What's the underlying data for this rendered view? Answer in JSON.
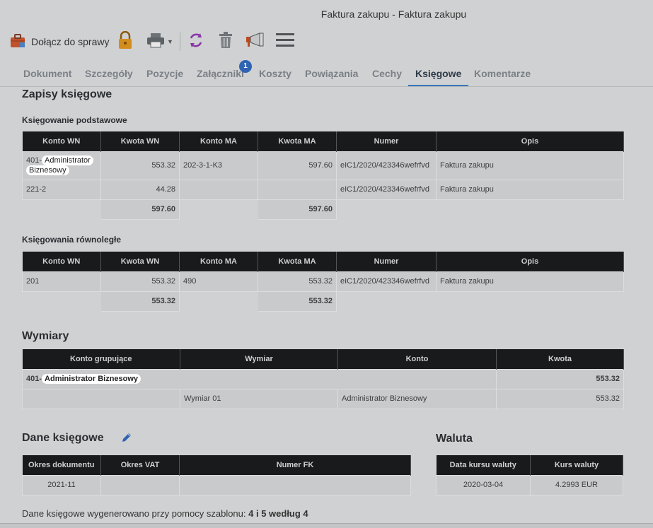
{
  "window": {
    "title": "Faktura zakupu - Faktura zakupu"
  },
  "toolbar": {
    "join_label": "Dołącz do sprawy",
    "icons": [
      "briefcase-icon",
      "lock-icon",
      "printer-icon",
      "refresh-icon",
      "trash-icon",
      "megaphone-icon",
      "menu-icon"
    ]
  },
  "tabs": [
    {
      "label": "Dokument"
    },
    {
      "label": "Szczegóły"
    },
    {
      "label": "Pozycje"
    },
    {
      "label": "Załączniki",
      "badge": "1"
    },
    {
      "label": "Koszty"
    },
    {
      "label": "Powiązania"
    },
    {
      "label": "Cechy"
    },
    {
      "label": "Księgowe",
      "active": true
    },
    {
      "label": "Komentarze"
    }
  ],
  "zapisy": {
    "title": "Zapisy księgowe",
    "podstawowe": {
      "title": "Księgowanie podstawowe",
      "headers": [
        "Konto WN",
        "Kwota WN",
        "Konto MA",
        "Kwota MA",
        "Numer",
        "Opis"
      ],
      "rows": [
        {
          "konto_wn_prefix": "401-",
          "konto_wn_name_1": "Administrator",
          "konto_wn_name_2": "Biznesowy",
          "kwota_wn": "553.32",
          "konto_ma": "202-3-1-K3",
          "kwota_ma": "597.60",
          "numer": "eIC1/2020/423346wefrfvd",
          "opis": "Faktura zakupu"
        },
        {
          "konto_wn": "221-2",
          "kwota_wn": "44.28",
          "konto_ma": "",
          "kwota_ma": "",
          "numer": "eIC1/2020/423346wefrfvd",
          "opis": "Faktura zakupu"
        }
      ],
      "sum_wn": "597.60",
      "sum_ma": "597.60"
    },
    "rownolegle": {
      "title": "Księgowania równoległe",
      "headers": [
        "Konto WN",
        "Kwota WN",
        "Konto MA",
        "Kwota MA",
        "Numer",
        "Opis"
      ],
      "rows": [
        {
          "konto_wn": "201",
          "kwota_wn": "553.32",
          "konto_ma": "490",
          "kwota_ma": "553.32",
          "numer": "eIC1/2020/423346wefrfvd",
          "opis": "Faktura zakupu"
        }
      ],
      "sum_wn": "553.32",
      "sum_ma": "553.32"
    }
  },
  "wymiary": {
    "title": "Wymiary",
    "headers": [
      "Konto grupujące",
      "Wymiar",
      "Konto",
      "Kwota"
    ],
    "group": {
      "prefix": "401-",
      "name": "Administrator Biznesowy",
      "kwota": "553.32"
    },
    "rows": [
      {
        "wymiar": "Wymiar 01",
        "konto": "Administrator Biznesowy",
        "kwota": "553.32"
      }
    ]
  },
  "dane": {
    "title": "Dane księgowe",
    "headers": [
      "Okres dokumentu",
      "Okres VAT",
      "Numer FK"
    ],
    "row": {
      "okres_dokumentu": "2021-11",
      "okres_vat": "",
      "numer_fk": ""
    }
  },
  "waluta": {
    "title": "Waluta",
    "headers": [
      "Data kursu waluty",
      "Kurs waluty"
    ],
    "row": {
      "data": "2020-03-04",
      "kurs": "4.2993 EUR"
    }
  },
  "footnote": {
    "text": "Dane księgowe wygenerowano przy pomocy szablonu: ",
    "template": "4 i 5 według 4"
  }
}
